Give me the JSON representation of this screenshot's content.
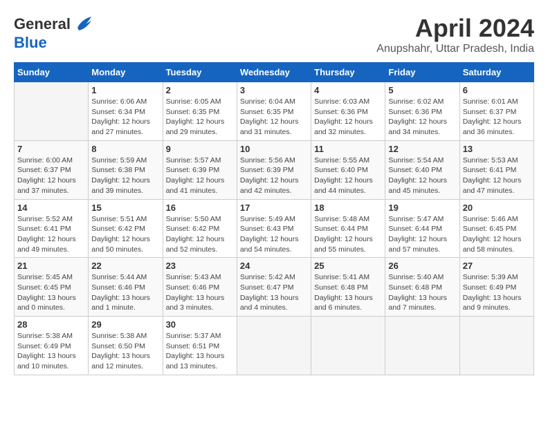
{
  "logo": {
    "line1": "General",
    "line2": "Blue"
  },
  "title": "April 2024",
  "subtitle": "Anupshahr, Uttar Pradesh, India",
  "days_of_week": [
    "Sunday",
    "Monday",
    "Tuesday",
    "Wednesday",
    "Thursday",
    "Friday",
    "Saturday"
  ],
  "weeks": [
    [
      {
        "day": "",
        "info": ""
      },
      {
        "day": "1",
        "info": "Sunrise: 6:06 AM\nSunset: 6:34 PM\nDaylight: 12 hours\nand 27 minutes."
      },
      {
        "day": "2",
        "info": "Sunrise: 6:05 AM\nSunset: 6:35 PM\nDaylight: 12 hours\nand 29 minutes."
      },
      {
        "day": "3",
        "info": "Sunrise: 6:04 AM\nSunset: 6:35 PM\nDaylight: 12 hours\nand 31 minutes."
      },
      {
        "day": "4",
        "info": "Sunrise: 6:03 AM\nSunset: 6:36 PM\nDaylight: 12 hours\nand 32 minutes."
      },
      {
        "day": "5",
        "info": "Sunrise: 6:02 AM\nSunset: 6:36 PM\nDaylight: 12 hours\nand 34 minutes."
      },
      {
        "day": "6",
        "info": "Sunrise: 6:01 AM\nSunset: 6:37 PM\nDaylight: 12 hours\nand 36 minutes."
      }
    ],
    [
      {
        "day": "7",
        "info": "Sunrise: 6:00 AM\nSunset: 6:37 PM\nDaylight: 12 hours\nand 37 minutes."
      },
      {
        "day": "8",
        "info": "Sunrise: 5:59 AM\nSunset: 6:38 PM\nDaylight: 12 hours\nand 39 minutes."
      },
      {
        "day": "9",
        "info": "Sunrise: 5:57 AM\nSunset: 6:39 PM\nDaylight: 12 hours\nand 41 minutes."
      },
      {
        "day": "10",
        "info": "Sunrise: 5:56 AM\nSunset: 6:39 PM\nDaylight: 12 hours\nand 42 minutes."
      },
      {
        "day": "11",
        "info": "Sunrise: 5:55 AM\nSunset: 6:40 PM\nDaylight: 12 hours\nand 44 minutes."
      },
      {
        "day": "12",
        "info": "Sunrise: 5:54 AM\nSunset: 6:40 PM\nDaylight: 12 hours\nand 45 minutes."
      },
      {
        "day": "13",
        "info": "Sunrise: 5:53 AM\nSunset: 6:41 PM\nDaylight: 12 hours\nand 47 minutes."
      }
    ],
    [
      {
        "day": "14",
        "info": "Sunrise: 5:52 AM\nSunset: 6:41 PM\nDaylight: 12 hours\nand 49 minutes."
      },
      {
        "day": "15",
        "info": "Sunrise: 5:51 AM\nSunset: 6:42 PM\nDaylight: 12 hours\nand 50 minutes."
      },
      {
        "day": "16",
        "info": "Sunrise: 5:50 AM\nSunset: 6:42 PM\nDaylight: 12 hours\nand 52 minutes."
      },
      {
        "day": "17",
        "info": "Sunrise: 5:49 AM\nSunset: 6:43 PM\nDaylight: 12 hours\nand 54 minutes."
      },
      {
        "day": "18",
        "info": "Sunrise: 5:48 AM\nSunset: 6:44 PM\nDaylight: 12 hours\nand 55 minutes."
      },
      {
        "day": "19",
        "info": "Sunrise: 5:47 AM\nSunset: 6:44 PM\nDaylight: 12 hours\nand 57 minutes."
      },
      {
        "day": "20",
        "info": "Sunrise: 5:46 AM\nSunset: 6:45 PM\nDaylight: 12 hours\nand 58 minutes."
      }
    ],
    [
      {
        "day": "21",
        "info": "Sunrise: 5:45 AM\nSunset: 6:45 PM\nDaylight: 13 hours\nand 0 minutes."
      },
      {
        "day": "22",
        "info": "Sunrise: 5:44 AM\nSunset: 6:46 PM\nDaylight: 13 hours\nand 1 minute."
      },
      {
        "day": "23",
        "info": "Sunrise: 5:43 AM\nSunset: 6:46 PM\nDaylight: 13 hours\nand 3 minutes."
      },
      {
        "day": "24",
        "info": "Sunrise: 5:42 AM\nSunset: 6:47 PM\nDaylight: 13 hours\nand 4 minutes."
      },
      {
        "day": "25",
        "info": "Sunrise: 5:41 AM\nSunset: 6:48 PM\nDaylight: 13 hours\nand 6 minutes."
      },
      {
        "day": "26",
        "info": "Sunrise: 5:40 AM\nSunset: 6:48 PM\nDaylight: 13 hours\nand 7 minutes."
      },
      {
        "day": "27",
        "info": "Sunrise: 5:39 AM\nSunset: 6:49 PM\nDaylight: 13 hours\nand 9 minutes."
      }
    ],
    [
      {
        "day": "28",
        "info": "Sunrise: 5:38 AM\nSunset: 6:49 PM\nDaylight: 13 hours\nand 10 minutes."
      },
      {
        "day": "29",
        "info": "Sunrise: 5:38 AM\nSunset: 6:50 PM\nDaylight: 13 hours\nand 12 minutes."
      },
      {
        "day": "30",
        "info": "Sunrise: 5:37 AM\nSunset: 6:51 PM\nDaylight: 13 hours\nand 13 minutes."
      },
      {
        "day": "",
        "info": ""
      },
      {
        "day": "",
        "info": ""
      },
      {
        "day": "",
        "info": ""
      },
      {
        "day": "",
        "info": ""
      }
    ]
  ]
}
